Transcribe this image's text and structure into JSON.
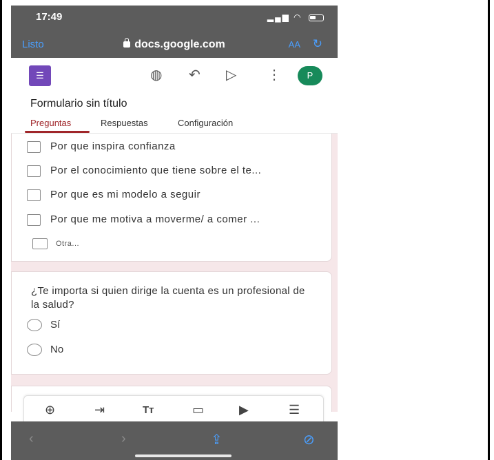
{
  "status": {
    "time": "17:49",
    "signal": "..ıl"
  },
  "browser": {
    "done_label": "Listo",
    "url": "docs.google.com",
    "text_size_label": "AA",
    "reload_icon": "reload-icon"
  },
  "forms": {
    "title": "Formulario sin título",
    "avatar_letter": "P",
    "tabs": [
      "Preguntas",
      "Respuestas",
      "Configuración"
    ],
    "active_tab": "Preguntas",
    "accent_color": "#a0262a",
    "brand_color": "#7248b9"
  },
  "question1": {
    "options": [
      "Por que inspira confianza",
      "Por el conocimiento que tiene sobre el te...",
      "Por que es mi modelo a seguir",
      "Por que me motiva a moverme/ a comer ...",
      "Otra..."
    ]
  },
  "question2": {
    "text": "¿Te importa si quien dirige la cuenta es un profesional de la salud?",
    "options": [
      "Sí",
      "No"
    ]
  },
  "toolbar_icons": [
    "add-question-icon",
    "import-questions-icon",
    "add-title-icon",
    "add-image-icon",
    "add-video-icon",
    "add-section-icon"
  ],
  "safari_bottom_icons": [
    "back-icon",
    "forward-icon",
    "share-icon",
    "compass-icon"
  ]
}
